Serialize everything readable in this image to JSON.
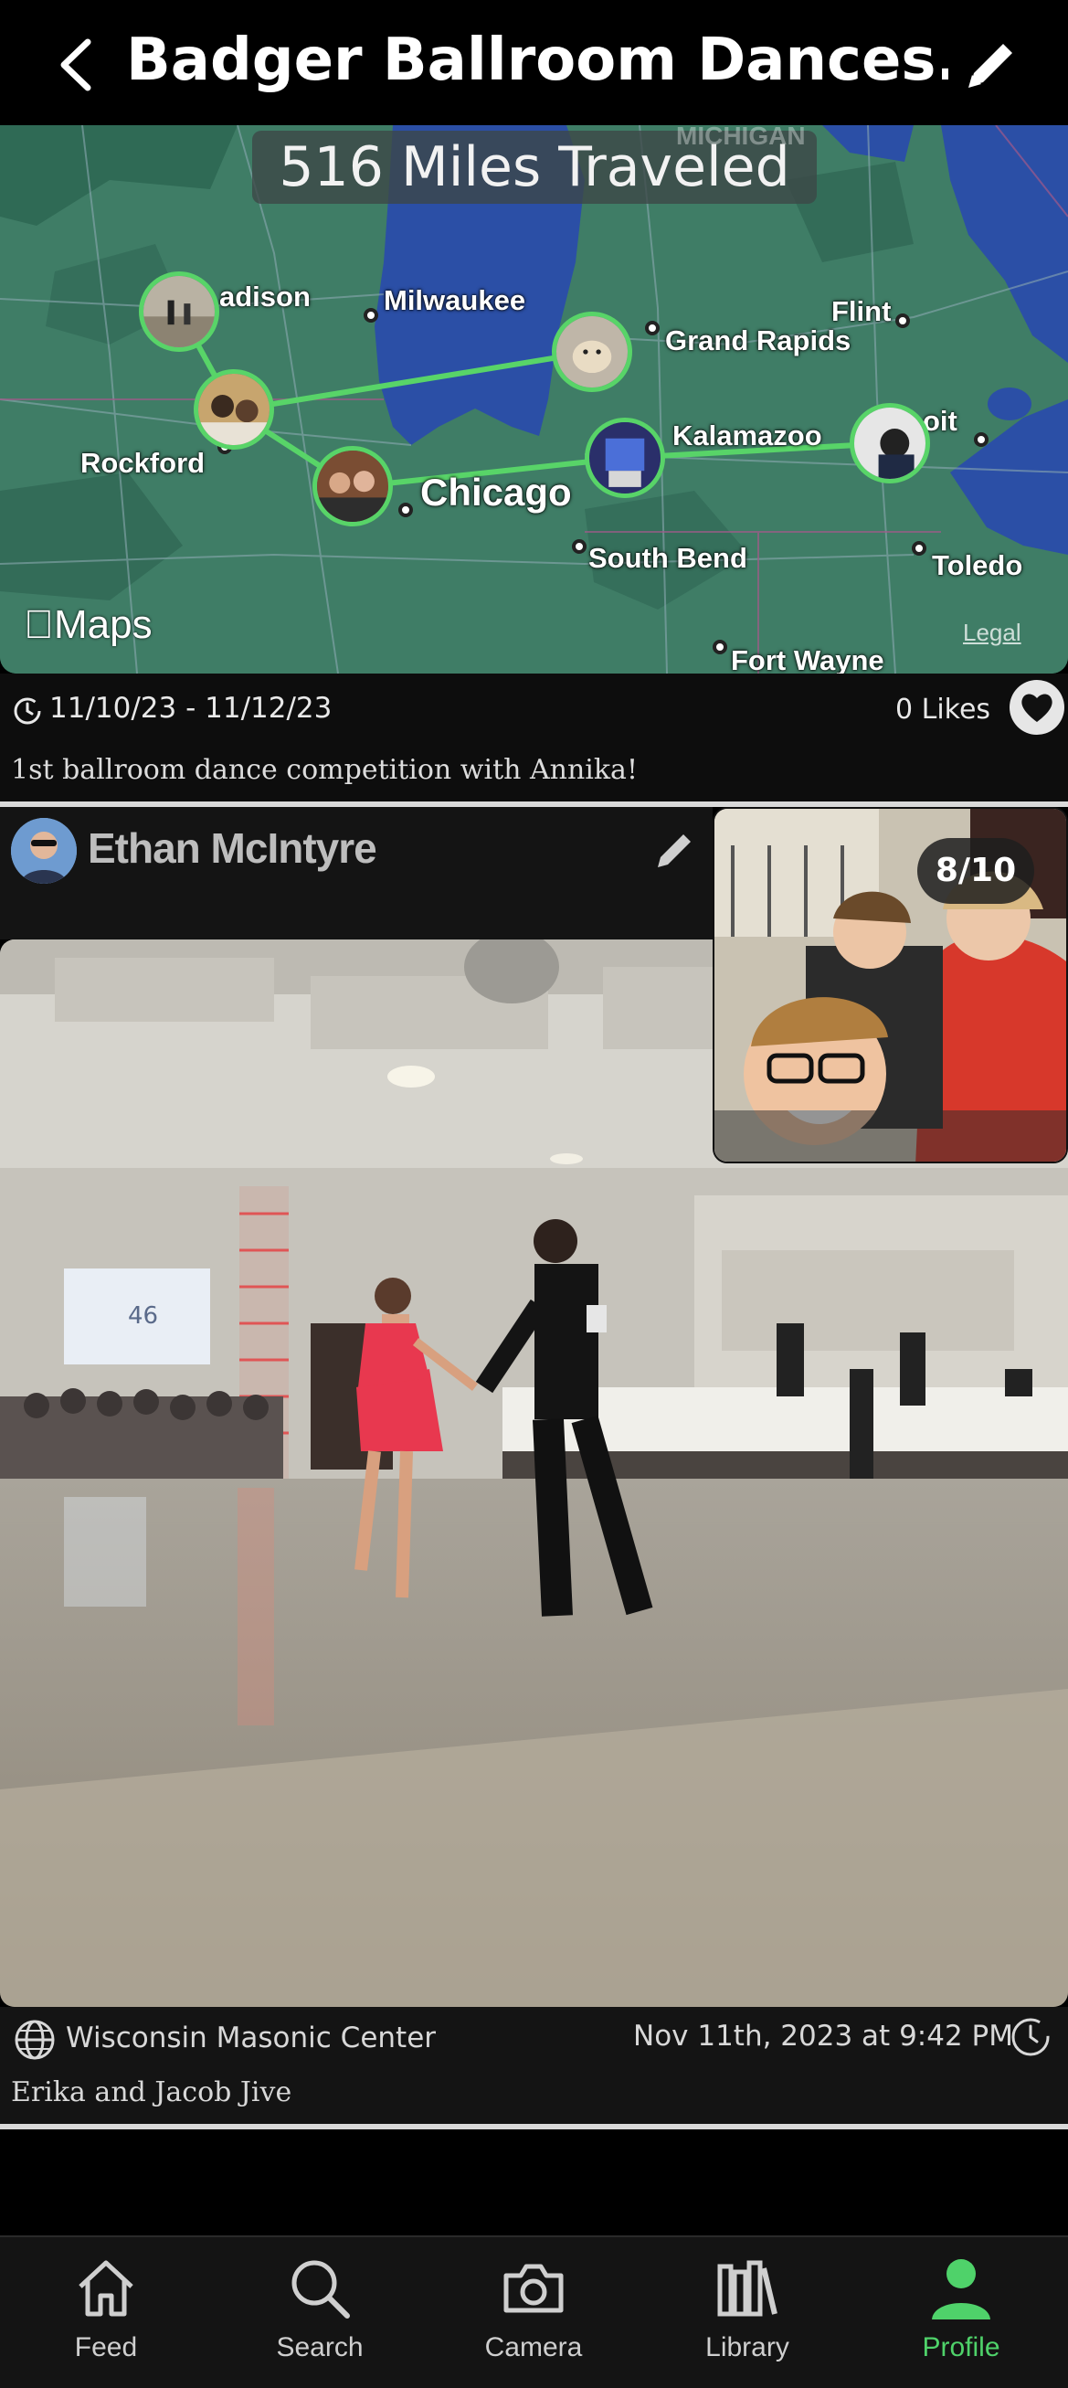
{
  "header": {
    "title": "Badger Ballroom Dances...",
    "back_icon": "chevron-left-icon",
    "edit_icon": "pencil-icon"
  },
  "map": {
    "banner": "516 Miles Traveled",
    "region_label": "MICHIGAN",
    "cities": {
      "madison": "adison",
      "milwaukee": "Milwaukee",
      "flint": "Flint",
      "grand_rapids": "Grand Rapids",
      "rockford": "Rockford",
      "kalamazoo": "Kalamazoo",
      "detroit": "oit",
      "chicago": "Chicago",
      "south_bend": "South Bend",
      "toledo": "Toledo",
      "fort_wayne": "Fort Wayne"
    },
    "logo": "Maps",
    "legal": "Legal",
    "route_color": "#58d468",
    "water_color": "#2b4fa6",
    "land_color": "#3d7a63"
  },
  "trip": {
    "dates": "11/10/23 - 11/12/23",
    "likes": "0 Likes",
    "description": "1st ballroom dance competition with Annika!"
  },
  "post": {
    "author": "Ethan McIntyre",
    "counter": "8/10",
    "location": "Wisconsin Masonic Center",
    "timestamp": "Nov 11th, 2023 at 9:42 PM",
    "caption": "Erika and Jacob Jive",
    "scoreboard_number": "46"
  },
  "tabs": [
    {
      "label": "Feed",
      "icon": "home-icon",
      "active": false
    },
    {
      "label": "Search",
      "icon": "search-icon",
      "active": false
    },
    {
      "label": "Camera",
      "icon": "camera-icon",
      "active": false
    },
    {
      "label": "Library",
      "icon": "library-icon",
      "active": false
    },
    {
      "label": "Profile",
      "icon": "person-icon",
      "active": true
    }
  ],
  "colors": {
    "accent": "#4fd26a",
    "background": "#000000",
    "card": "#141414"
  }
}
